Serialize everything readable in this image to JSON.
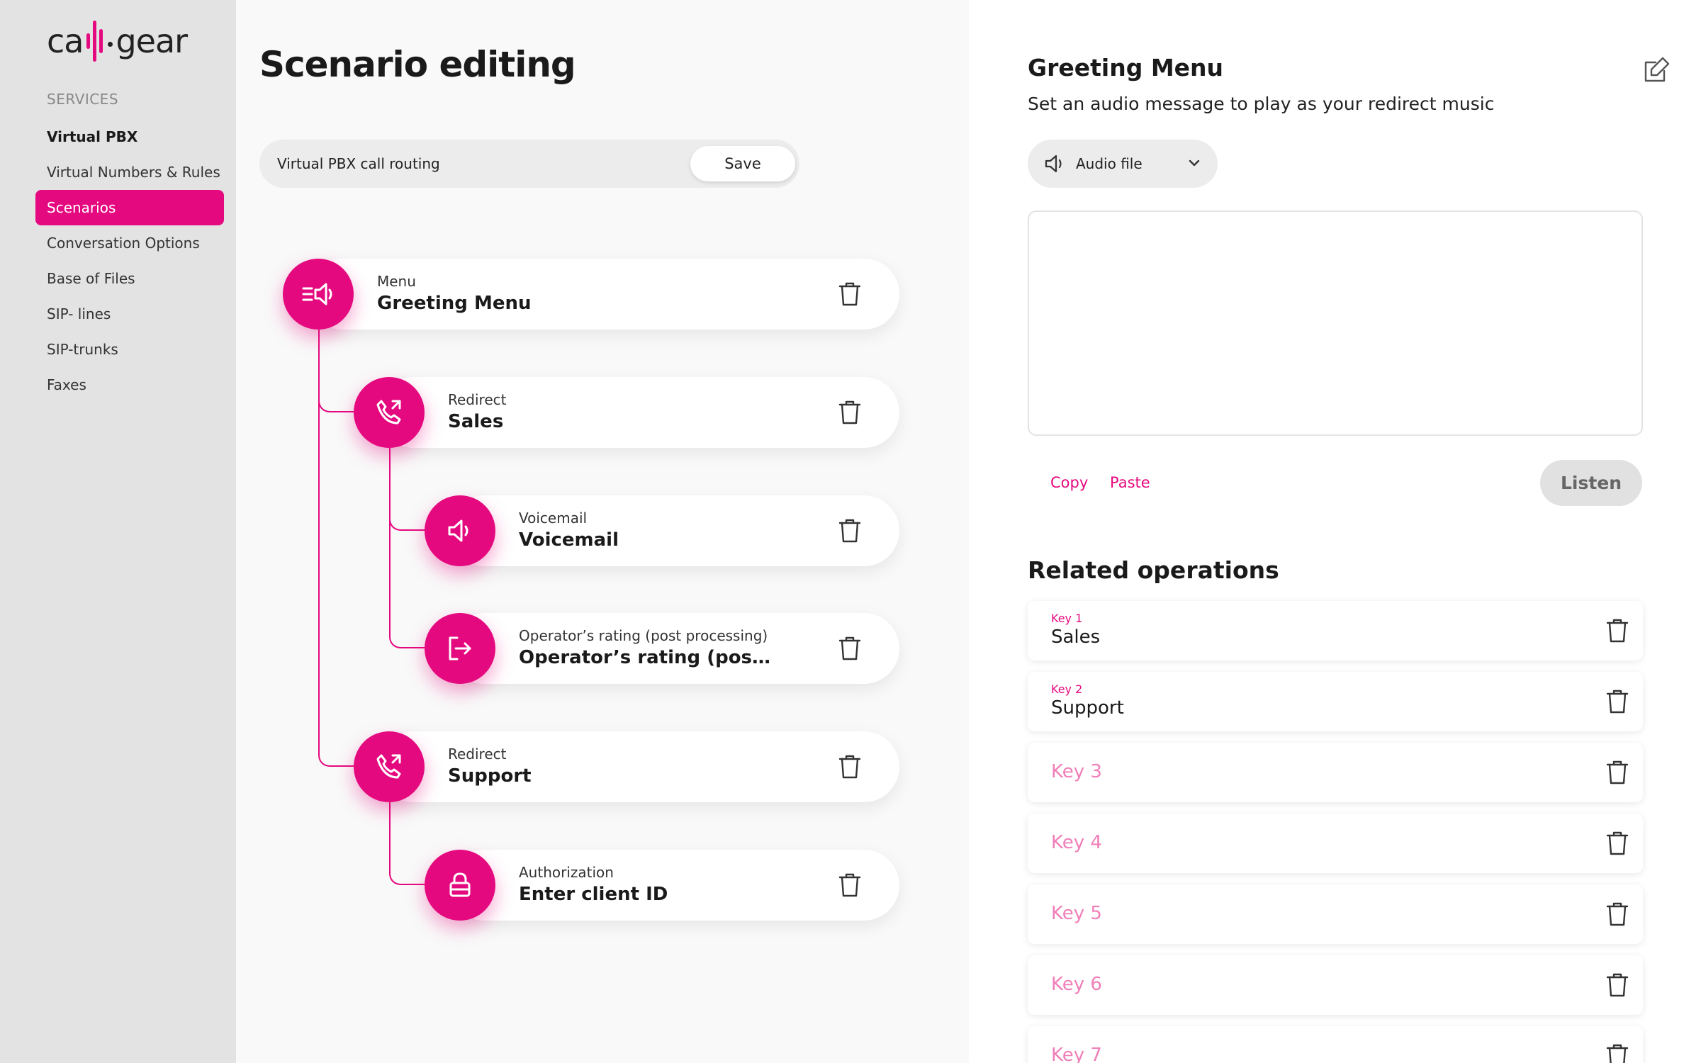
{
  "brand": {
    "logo_left": "ca",
    "logo_right": "gear",
    "accent_color": "#e5097f"
  },
  "sidebar": {
    "section_label": "SERVICES",
    "items": [
      {
        "label": "Virtual PBX"
      },
      {
        "label": "Virtual Numbers & Rules"
      },
      {
        "label": "Scenarios"
      },
      {
        "label": "Conversation Options"
      },
      {
        "label": "Base of Files"
      },
      {
        "label": "SIP- lines"
      },
      {
        "label": "SIP-trunks"
      },
      {
        "label": "Faxes"
      }
    ]
  },
  "main": {
    "title": "Scenario editing",
    "scenario_name": "Virtual PBX call routing",
    "save_label": "Save",
    "nodes": [
      {
        "type": "Menu",
        "name": "Greeting Menu",
        "icon": "menu-speaker-icon"
      },
      {
        "type": "Redirect",
        "name": "Sales",
        "icon": "phone-forward-icon"
      },
      {
        "type": "Voicemail",
        "name": "Voicemail",
        "icon": "speaker-icon"
      },
      {
        "type": "Operator’s rating (post processing)",
        "name": "Operator’s rating (post pro...",
        "icon": "exit-arrow-icon"
      },
      {
        "type": "Redirect",
        "name": "Support",
        "icon": "phone-forward-icon"
      },
      {
        "type": "Authorization",
        "name": "Enter client ID",
        "icon": "lock-icon"
      }
    ]
  },
  "panel": {
    "title": "Greeting Menu",
    "subtitle": "Set an audio message to play as your redirect music",
    "audio_source": "Audio file",
    "copy_label": "Copy",
    "paste_label": "Paste",
    "listen_label": "Listen",
    "related_title": "Related operations",
    "keys": [
      {
        "key": "Key 1",
        "value": "Sales"
      },
      {
        "key": "Key 2",
        "value": "Support"
      },
      {
        "key": "Key 3",
        "value": ""
      },
      {
        "key": "Key 4",
        "value": ""
      },
      {
        "key": "Key 5",
        "value": ""
      },
      {
        "key": "Key 6",
        "value": ""
      },
      {
        "key": "Key 7",
        "value": ""
      }
    ]
  }
}
